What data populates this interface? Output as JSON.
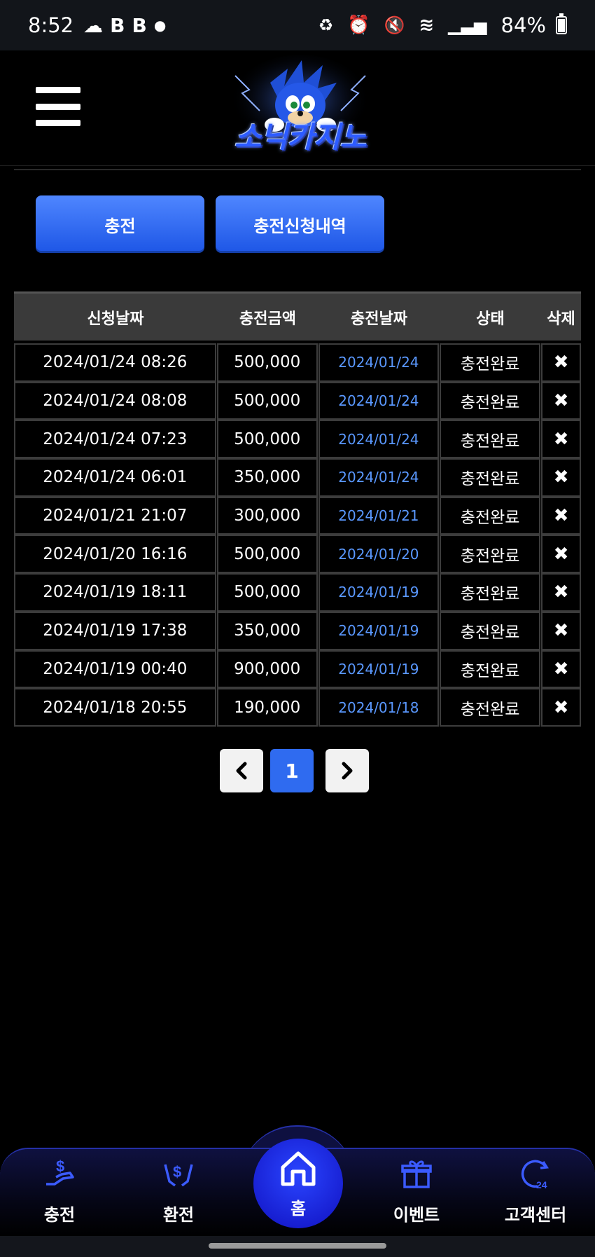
{
  "status_bar": {
    "time": "8:52",
    "left_icons": [
      "chat-icon",
      "b-icon",
      "b-icon",
      "dot-icon"
    ],
    "right_icons": [
      "battery-saver-icon",
      "alarm-icon",
      "mute-icon",
      "wifi-icon",
      "signal-icon"
    ],
    "battery": "84%"
  },
  "header": {
    "logo_text": "소닉카지노",
    "logo_colors": {
      "primary": "#2d5bff",
      "glow": "#7ea0ff"
    }
  },
  "tabs": {
    "charge": "충전",
    "history": "충전신청내역"
  },
  "table": {
    "headers": [
      "신청날짜",
      "충전금액",
      "충전날짜",
      "상태",
      "삭제"
    ],
    "rows": [
      {
        "request_date": "2024/01/24 08:26",
        "amount": "500,000",
        "charge_date": "2024/01/24",
        "status": "충전완료",
        "delete": "✖"
      },
      {
        "request_date": "2024/01/24 08:08",
        "amount": "500,000",
        "charge_date": "2024/01/24",
        "status": "충전완료",
        "delete": "✖"
      },
      {
        "request_date": "2024/01/24 07:23",
        "amount": "500,000",
        "charge_date": "2024/01/24",
        "status": "충전완료",
        "delete": "✖"
      },
      {
        "request_date": "2024/01/24 06:01",
        "amount": "350,000",
        "charge_date": "2024/01/24",
        "status": "충전완료",
        "delete": "✖"
      },
      {
        "request_date": "2024/01/21 21:07",
        "amount": "300,000",
        "charge_date": "2024/01/21",
        "status": "충전완료",
        "delete": "✖"
      },
      {
        "request_date": "2024/01/20 16:16",
        "amount": "500,000",
        "charge_date": "2024/01/20",
        "status": "충전완료",
        "delete": "✖"
      },
      {
        "request_date": "2024/01/19 18:11",
        "amount": "500,000",
        "charge_date": "2024/01/19",
        "status": "충전완료",
        "delete": "✖"
      },
      {
        "request_date": "2024/01/19 17:38",
        "amount": "350,000",
        "charge_date": "2024/01/19",
        "status": "충전완료",
        "delete": "✖"
      },
      {
        "request_date": "2024/01/19 00:40",
        "amount": "900,000",
        "charge_date": "2024/01/19",
        "status": "충전완료",
        "delete": "✖"
      },
      {
        "request_date": "2024/01/18 20:55",
        "amount": "190,000",
        "charge_date": "2024/01/18",
        "status": "충전완료",
        "delete": "✖"
      }
    ]
  },
  "pagination": {
    "prev": "‹",
    "current": "1",
    "next": "›"
  },
  "bottom_nav": {
    "charge": {
      "label": "충전",
      "icon": "hand-money-icon"
    },
    "withdraw": {
      "label": "환전",
      "icon": "hands-money-icon"
    },
    "home": {
      "label": "홈",
      "icon": "home-icon"
    },
    "event": {
      "label": "이벤트",
      "icon": "gift-icon"
    },
    "support": {
      "label": "고객센터",
      "icon": "support-24-icon"
    }
  },
  "colors": {
    "accent": "#2f6bf0",
    "date_blue": "#5a98ff",
    "nav_blue": "#3b5bff"
  }
}
